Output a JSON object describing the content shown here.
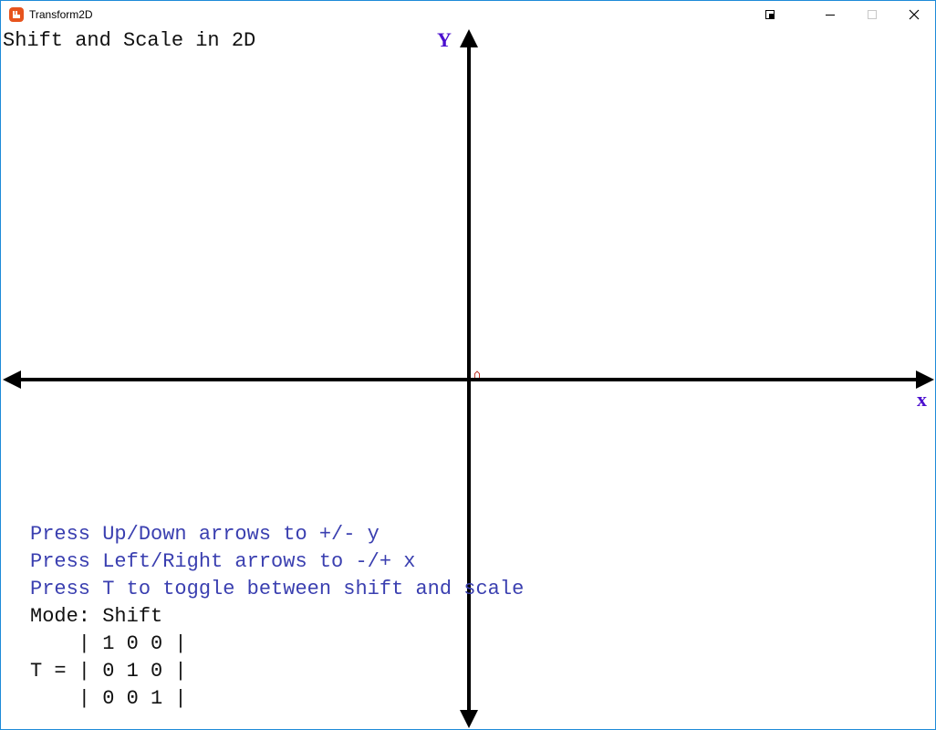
{
  "window": {
    "title": "Transform2D",
    "controls": {
      "minimize_icon": "minimize-icon",
      "maximize_icon": "maximize-icon",
      "close_icon": "close-icon"
    },
    "border_color": "#1e8ad8",
    "icon_color": "#e7541e"
  },
  "scene": {
    "title": "Shift and Scale in 2D",
    "axis_labels": {
      "y": "Y",
      "x": "x"
    },
    "axis_label_color": "#4b0fcf"
  },
  "instructions": {
    "lines": [
      "Press Up/Down arrows to +/- y",
      "Press Left/Right arrows to -/+ x",
      "Press T to toggle between shift and scale"
    ],
    "color": "#3a3fb0"
  },
  "status": {
    "mode_text": "Mode: Shift"
  },
  "matrix": {
    "rows": [
      "    | 1 0 0 |",
      "T = | 0 1 0 |",
      "    | 0 0 1 |"
    ]
  }
}
